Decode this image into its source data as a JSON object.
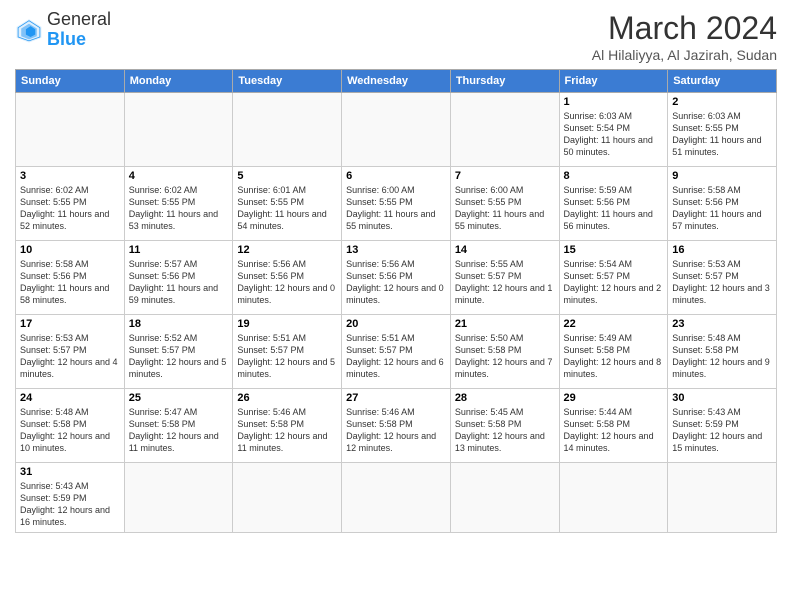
{
  "header": {
    "logo_text_general": "General",
    "logo_text_blue": "Blue",
    "month_title": "March 2024",
    "location": "Al Hilaliyya, Al Jazirah, Sudan"
  },
  "weekdays": [
    "Sunday",
    "Monday",
    "Tuesday",
    "Wednesday",
    "Thursday",
    "Friday",
    "Saturday"
  ],
  "weeks": [
    [
      {
        "day": "",
        "sunrise": "",
        "sunset": "",
        "daylight": "",
        "empty": true
      },
      {
        "day": "",
        "sunrise": "",
        "sunset": "",
        "daylight": "",
        "empty": true
      },
      {
        "day": "",
        "sunrise": "",
        "sunset": "",
        "daylight": "",
        "empty": true
      },
      {
        "day": "",
        "sunrise": "",
        "sunset": "",
        "daylight": "",
        "empty": true
      },
      {
        "day": "",
        "sunrise": "",
        "sunset": "",
        "daylight": "",
        "empty": true
      },
      {
        "day": "1",
        "sunrise": "Sunrise: 6:03 AM",
        "sunset": "Sunset: 5:54 PM",
        "daylight": "Daylight: 11 hours and 50 minutes.",
        "empty": false
      },
      {
        "day": "2",
        "sunrise": "Sunrise: 6:03 AM",
        "sunset": "Sunset: 5:55 PM",
        "daylight": "Daylight: 11 hours and 51 minutes.",
        "empty": false
      }
    ],
    [
      {
        "day": "3",
        "sunrise": "Sunrise: 6:02 AM",
        "sunset": "Sunset: 5:55 PM",
        "daylight": "Daylight: 11 hours and 52 minutes.",
        "empty": false
      },
      {
        "day": "4",
        "sunrise": "Sunrise: 6:02 AM",
        "sunset": "Sunset: 5:55 PM",
        "daylight": "Daylight: 11 hours and 53 minutes.",
        "empty": false
      },
      {
        "day": "5",
        "sunrise": "Sunrise: 6:01 AM",
        "sunset": "Sunset: 5:55 PM",
        "daylight": "Daylight: 11 hours and 54 minutes.",
        "empty": false
      },
      {
        "day": "6",
        "sunrise": "Sunrise: 6:00 AM",
        "sunset": "Sunset: 5:55 PM",
        "daylight": "Daylight: 11 hours and 55 minutes.",
        "empty": false
      },
      {
        "day": "7",
        "sunrise": "Sunrise: 6:00 AM",
        "sunset": "Sunset: 5:55 PM",
        "daylight": "Daylight: 11 hours and 55 minutes.",
        "empty": false
      },
      {
        "day": "8",
        "sunrise": "Sunrise: 5:59 AM",
        "sunset": "Sunset: 5:56 PM",
        "daylight": "Daylight: 11 hours and 56 minutes.",
        "empty": false
      },
      {
        "day": "9",
        "sunrise": "Sunrise: 5:58 AM",
        "sunset": "Sunset: 5:56 PM",
        "daylight": "Daylight: 11 hours and 57 minutes.",
        "empty": false
      }
    ],
    [
      {
        "day": "10",
        "sunrise": "Sunrise: 5:58 AM",
        "sunset": "Sunset: 5:56 PM",
        "daylight": "Daylight: 11 hours and 58 minutes.",
        "empty": false
      },
      {
        "day": "11",
        "sunrise": "Sunrise: 5:57 AM",
        "sunset": "Sunset: 5:56 PM",
        "daylight": "Daylight: 11 hours and 59 minutes.",
        "empty": false
      },
      {
        "day": "12",
        "sunrise": "Sunrise: 5:56 AM",
        "sunset": "Sunset: 5:56 PM",
        "daylight": "Daylight: 12 hours and 0 minutes.",
        "empty": false
      },
      {
        "day": "13",
        "sunrise": "Sunrise: 5:56 AM",
        "sunset": "Sunset: 5:56 PM",
        "daylight": "Daylight: 12 hours and 0 minutes.",
        "empty": false
      },
      {
        "day": "14",
        "sunrise": "Sunrise: 5:55 AM",
        "sunset": "Sunset: 5:57 PM",
        "daylight": "Daylight: 12 hours and 1 minute.",
        "empty": false
      },
      {
        "day": "15",
        "sunrise": "Sunrise: 5:54 AM",
        "sunset": "Sunset: 5:57 PM",
        "daylight": "Daylight: 12 hours and 2 minutes.",
        "empty": false
      },
      {
        "day": "16",
        "sunrise": "Sunrise: 5:53 AM",
        "sunset": "Sunset: 5:57 PM",
        "daylight": "Daylight: 12 hours and 3 minutes.",
        "empty": false
      }
    ],
    [
      {
        "day": "17",
        "sunrise": "Sunrise: 5:53 AM",
        "sunset": "Sunset: 5:57 PM",
        "daylight": "Daylight: 12 hours and 4 minutes.",
        "empty": false
      },
      {
        "day": "18",
        "sunrise": "Sunrise: 5:52 AM",
        "sunset": "Sunset: 5:57 PM",
        "daylight": "Daylight: 12 hours and 5 minutes.",
        "empty": false
      },
      {
        "day": "19",
        "sunrise": "Sunrise: 5:51 AM",
        "sunset": "Sunset: 5:57 PM",
        "daylight": "Daylight: 12 hours and 5 minutes.",
        "empty": false
      },
      {
        "day": "20",
        "sunrise": "Sunrise: 5:51 AM",
        "sunset": "Sunset: 5:57 PM",
        "daylight": "Daylight: 12 hours and 6 minutes.",
        "empty": false
      },
      {
        "day": "21",
        "sunrise": "Sunrise: 5:50 AM",
        "sunset": "Sunset: 5:58 PM",
        "daylight": "Daylight: 12 hours and 7 minutes.",
        "empty": false
      },
      {
        "day": "22",
        "sunrise": "Sunrise: 5:49 AM",
        "sunset": "Sunset: 5:58 PM",
        "daylight": "Daylight: 12 hours and 8 minutes.",
        "empty": false
      },
      {
        "day": "23",
        "sunrise": "Sunrise: 5:48 AM",
        "sunset": "Sunset: 5:58 PM",
        "daylight": "Daylight: 12 hours and 9 minutes.",
        "empty": false
      }
    ],
    [
      {
        "day": "24",
        "sunrise": "Sunrise: 5:48 AM",
        "sunset": "Sunset: 5:58 PM",
        "daylight": "Daylight: 12 hours and 10 minutes.",
        "empty": false
      },
      {
        "day": "25",
        "sunrise": "Sunrise: 5:47 AM",
        "sunset": "Sunset: 5:58 PM",
        "daylight": "Daylight: 12 hours and 11 minutes.",
        "empty": false
      },
      {
        "day": "26",
        "sunrise": "Sunrise: 5:46 AM",
        "sunset": "Sunset: 5:58 PM",
        "daylight": "Daylight: 12 hours and 11 minutes.",
        "empty": false
      },
      {
        "day": "27",
        "sunrise": "Sunrise: 5:46 AM",
        "sunset": "Sunset: 5:58 PM",
        "daylight": "Daylight: 12 hours and 12 minutes.",
        "empty": false
      },
      {
        "day": "28",
        "sunrise": "Sunrise: 5:45 AM",
        "sunset": "Sunset: 5:58 PM",
        "daylight": "Daylight: 12 hours and 13 minutes.",
        "empty": false
      },
      {
        "day": "29",
        "sunrise": "Sunrise: 5:44 AM",
        "sunset": "Sunset: 5:58 PM",
        "daylight": "Daylight: 12 hours and 14 minutes.",
        "empty": false
      },
      {
        "day": "30",
        "sunrise": "Sunrise: 5:43 AM",
        "sunset": "Sunset: 5:59 PM",
        "daylight": "Daylight: 12 hours and 15 minutes.",
        "empty": false
      }
    ],
    [
      {
        "day": "31",
        "sunrise": "Sunrise: 5:43 AM",
        "sunset": "Sunset: 5:59 PM",
        "daylight": "Daylight: 12 hours and 16 minutes.",
        "empty": false
      },
      {
        "day": "",
        "sunrise": "",
        "sunset": "",
        "daylight": "",
        "empty": true
      },
      {
        "day": "",
        "sunrise": "",
        "sunset": "",
        "daylight": "",
        "empty": true
      },
      {
        "day": "",
        "sunrise": "",
        "sunset": "",
        "daylight": "",
        "empty": true
      },
      {
        "day": "",
        "sunrise": "",
        "sunset": "",
        "daylight": "",
        "empty": true
      },
      {
        "day": "",
        "sunrise": "",
        "sunset": "",
        "daylight": "",
        "empty": true
      },
      {
        "day": "",
        "sunrise": "",
        "sunset": "",
        "daylight": "",
        "empty": true
      }
    ]
  ]
}
